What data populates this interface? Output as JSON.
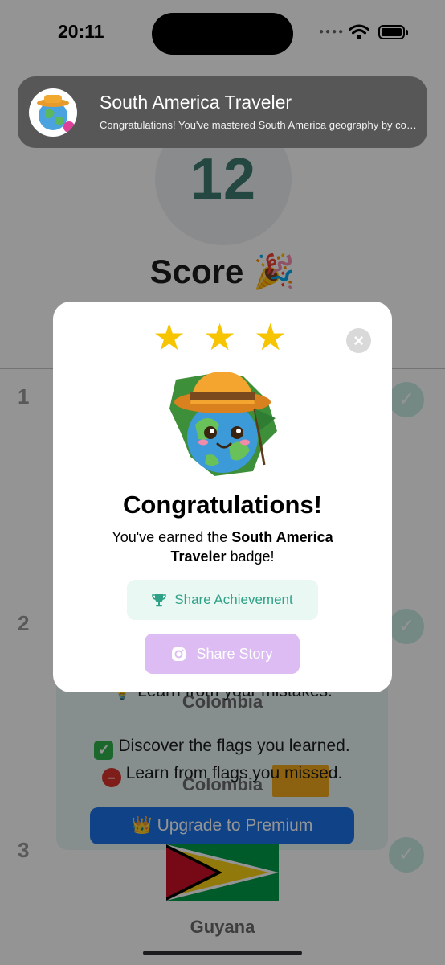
{
  "status_bar": {
    "time": "20:11"
  },
  "notification": {
    "title": "South America Traveler",
    "body": "Congratulations! You've mastered South America geography by completing the quiz."
  },
  "background": {
    "score_value": "12",
    "score_label": "Score 🎉",
    "rows": [
      {
        "number": "1",
        "country": "Colombia"
      },
      {
        "number": "2",
        "country": "Colombia"
      },
      {
        "number": "3",
        "country": "Guyana"
      }
    ],
    "promo": {
      "line1": "💡 Learn from your mistakes.",
      "line2": "Discover the flags you learned.",
      "line3": "Learn from flags you missed.",
      "check_glyph": "✓",
      "minus_glyph": "–",
      "upgrade_label": "👑 Upgrade to Premium"
    }
  },
  "modal": {
    "stars": [
      "★",
      "★",
      "★"
    ],
    "close_glyph": "×",
    "title": "Congratulations!",
    "desc_prefix": "You've earned the ",
    "badge_name": "South America Traveler",
    "desc_suffix": " badge!",
    "share_achievement_label": "Share Achievement",
    "share_story_label": "Share Story"
  },
  "colors": {
    "star": "#f6c400",
    "accent_teal": "#2fa187",
    "story_purple": "#dcbcf2",
    "premium_blue": "#1a73e8"
  },
  "icons": [
    "trophy-icon",
    "camera-icon",
    "close-icon",
    "wifi-icon",
    "battery-icon",
    "badge-mascot-icon"
  ]
}
